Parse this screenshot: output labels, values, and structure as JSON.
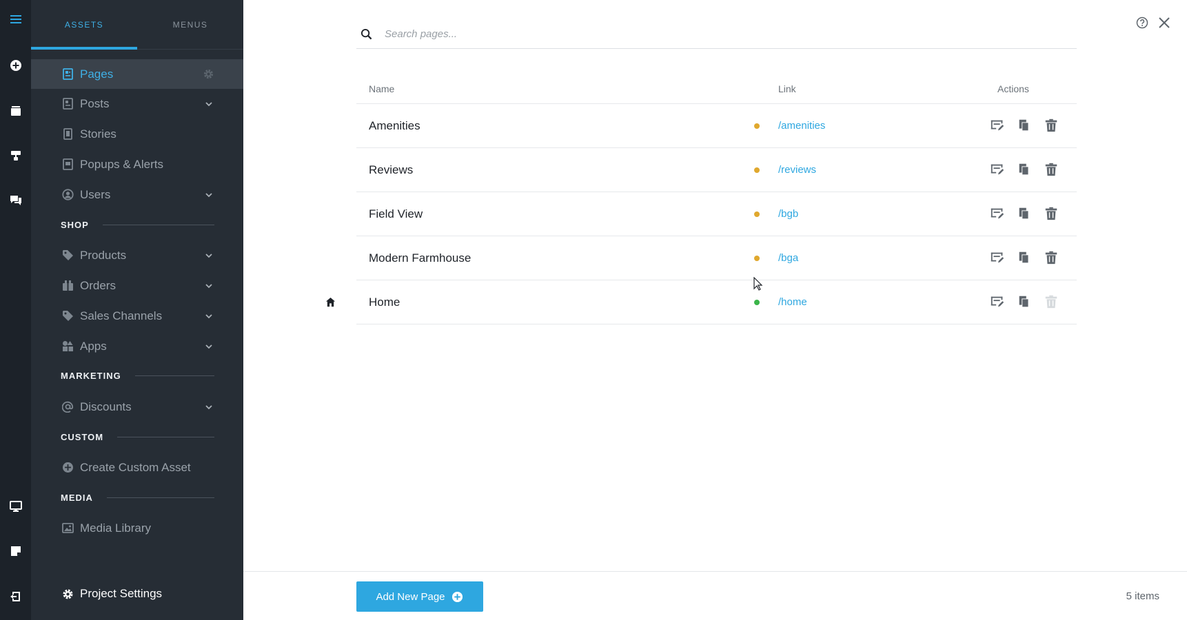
{
  "panel": {
    "tabs": [
      {
        "label": "ASSETS"
      },
      {
        "label": "MENUS"
      }
    ],
    "items": {
      "pages": "Pages",
      "posts": "Posts",
      "stories": "Stories",
      "popups": "Popups & Alerts",
      "users": "Users",
      "products": "Products",
      "orders": "Orders",
      "sales_channels": "Sales Channels",
      "apps": "Apps",
      "discounts": "Discounts",
      "create_custom_asset": "Create Custom Asset",
      "media_library": "Media Library"
    },
    "sections": {
      "shop": "SHOP",
      "marketing": "MARKETING",
      "custom": "CUSTOM",
      "media": "MEDIA"
    },
    "project_settings": "Project Settings"
  },
  "search": {
    "placeholder": "Search pages..."
  },
  "table": {
    "columns": {
      "name": "Name",
      "link": "Link",
      "actions": "Actions"
    },
    "rows": [
      {
        "name": "Amenities",
        "link": "/amenities",
        "status_color": "#e0a82e"
      },
      {
        "name": "Reviews",
        "link": "/reviews",
        "status_color": "#e0a82e"
      },
      {
        "name": "Field View",
        "link": "/bgb",
        "status_color": "#e0a82e"
      },
      {
        "name": "Modern Farmhouse",
        "link": "/bga",
        "status_color": "#e0a82e"
      },
      {
        "name": "Home",
        "link": "/home",
        "status_color": "#3bb54a"
      }
    ]
  },
  "footer": {
    "add_button_label": "Add New Page",
    "item_count": "5 items"
  },
  "colors": {
    "accent": "#2ea7e0",
    "draft": "#e0a82e",
    "published": "#3bb54a"
  }
}
